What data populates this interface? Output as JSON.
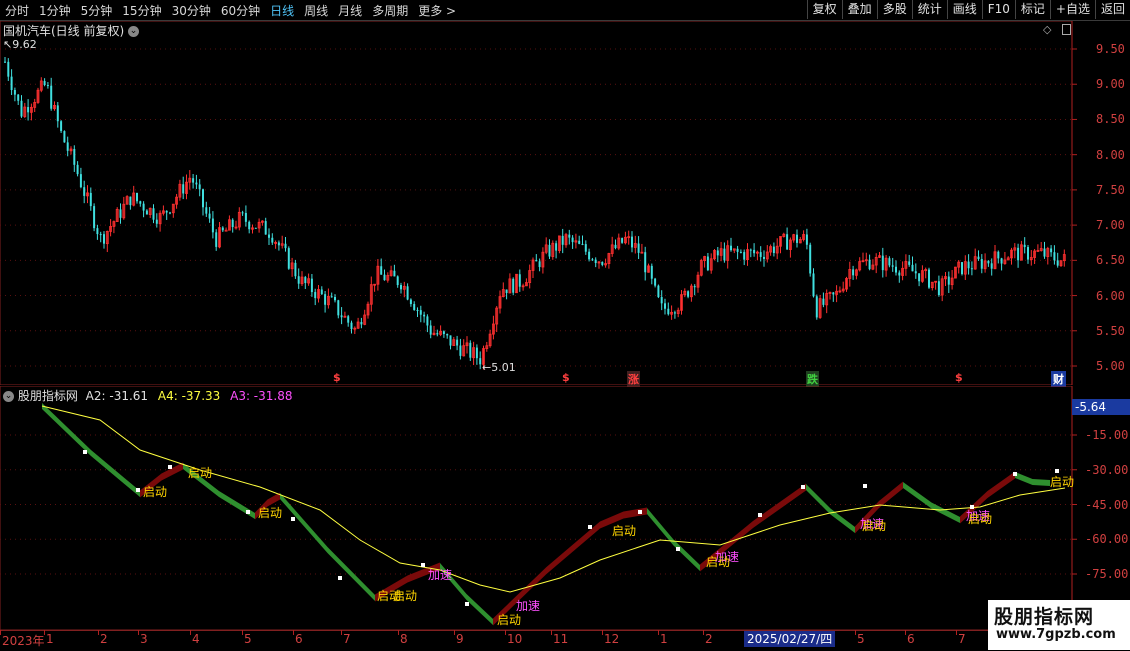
{
  "toolbar": {
    "periods": [
      "分时",
      "1分钟",
      "5分钟",
      "15分钟",
      "30分钟",
      "60分钟",
      "日线",
      "周线",
      "月线",
      "多周期",
      "更多 >"
    ],
    "active_period": "日线",
    "buttons": [
      "复权",
      "叠加",
      "多股",
      "统计",
      "画线",
      "F10",
      "标记",
      "+自选",
      "返回"
    ]
  },
  "main_panel": {
    "title": "国机汽车(日线 前复权)",
    "high_label": "9.62",
    "low_label": "5.01",
    "y_ticks": [
      "9.50",
      "9.00",
      "8.50",
      "8.00",
      "7.50",
      "7.00",
      "6.50",
      "6.00",
      "5.50",
      "5.00"
    ],
    "events": [
      {
        "text": "$",
        "color": "#ff4040"
      },
      {
        "text": "$",
        "color": "#ff4040"
      },
      {
        "text": "涨",
        "color": "#ff4040"
      },
      {
        "text": "跌",
        "color": "#40d040"
      },
      {
        "text": "$",
        "color": "#ff4040"
      },
      {
        "text": "财",
        "color": "#ffffff"
      }
    ]
  },
  "indicator_panel": {
    "name": "股朋指标网",
    "a2_label": "A2: -31.61",
    "a4_label": "A4: -37.33",
    "a3_label": "A3: -31.88",
    "current_value": "-5.64",
    "y_ticks": [
      "-15.00",
      "-30.00",
      "-45.00",
      "-60.00",
      "-75.00"
    ],
    "signals": {
      "start": "启动",
      "accel": "加速"
    }
  },
  "x_axis": {
    "labels": [
      "2023年",
      "1",
      "2",
      "3",
      "4",
      "5",
      "6",
      "7",
      "8",
      "9",
      "10",
      "11",
      "12",
      "1",
      "2",
      "5",
      "6",
      "7"
    ],
    "cursor_date": "2025/02/27/四"
  },
  "watermark": {
    "line1": "股朋指标网",
    "line2": "www.7gpzb.com"
  },
  "colors": {
    "up": "#ff3030",
    "down": "#40e0e0",
    "ma": "#ffff40",
    "rising_band": "#7a0a0a",
    "falling_band": "#2f8f2f",
    "axis": "#d04040"
  }
}
